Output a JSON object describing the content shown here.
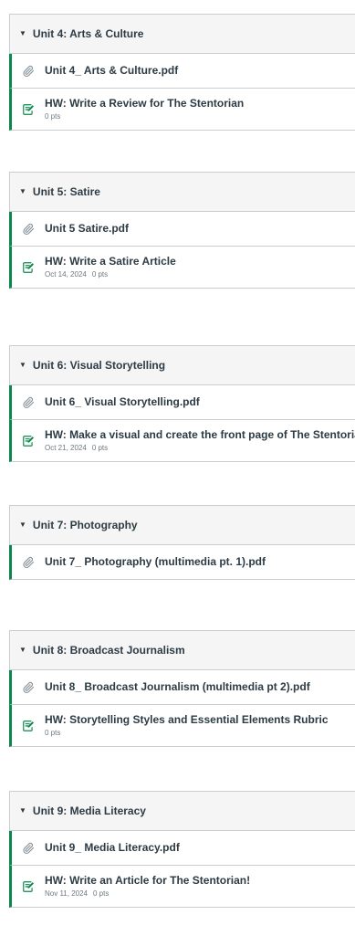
{
  "modules": [
    {
      "title": "Unit 4: Arts & Culture",
      "items": [
        {
          "kind": "file",
          "icon": "paperclip-icon",
          "title": "Unit 4_ Arts & Culture.pdf"
        },
        {
          "kind": "assignment",
          "icon": "assignment-icon",
          "title": "HW: Write a Review for The Stentorian",
          "date": "",
          "points": "0 pts"
        }
      ]
    },
    {
      "title": "Unit 5: Satire",
      "items": [
        {
          "kind": "file",
          "icon": "paperclip-icon",
          "title": "Unit 5 Satire.pdf"
        },
        {
          "kind": "assignment",
          "icon": "assignment-icon",
          "title": "HW: Write a Satire Article",
          "date": "Oct 14, 2024",
          "points": "0 pts"
        }
      ]
    },
    {
      "title": "Unit 6: Visual Storytelling",
      "items": [
        {
          "kind": "file",
          "icon": "paperclip-icon",
          "title": "Unit 6_ Visual Storytelling.pdf"
        },
        {
          "kind": "assignment",
          "icon": "assignment-icon",
          "title": "HW: Make a visual and create the front page of The Stentorian",
          "date": "Oct 21, 2024",
          "points": "0 pts"
        }
      ]
    },
    {
      "title": "Unit 7: Photography",
      "items": [
        {
          "kind": "file",
          "icon": "paperclip-icon",
          "title": "Unit 7_ Photography (multimedia pt. 1).pdf"
        }
      ]
    },
    {
      "title": "Unit 8: Broadcast Journalism",
      "items": [
        {
          "kind": "file",
          "icon": "paperclip-icon",
          "title": "Unit 8_ Broadcast Journalism (multimedia pt 2).pdf"
        },
        {
          "kind": "assignment",
          "icon": "assignment-icon",
          "title": "HW: Storytelling Styles and Essential Elements Rubric",
          "date": "",
          "points": "0 pts"
        }
      ]
    },
    {
      "title": "Unit 9: Media Literacy",
      "items": [
        {
          "kind": "file",
          "icon": "paperclip-icon",
          "title": "Unit 9_ Media Literacy.pdf"
        },
        {
          "kind": "assignment",
          "icon": "assignment-icon",
          "title": "HW: Write an Article for The Stentorian!",
          "date": "Nov 11, 2024",
          "points": "0 pts"
        }
      ]
    }
  ],
  "colors": {
    "accent_bar": "#0b874b",
    "icon_green": "#0b874b",
    "file_icon": "#8b969e"
  }
}
